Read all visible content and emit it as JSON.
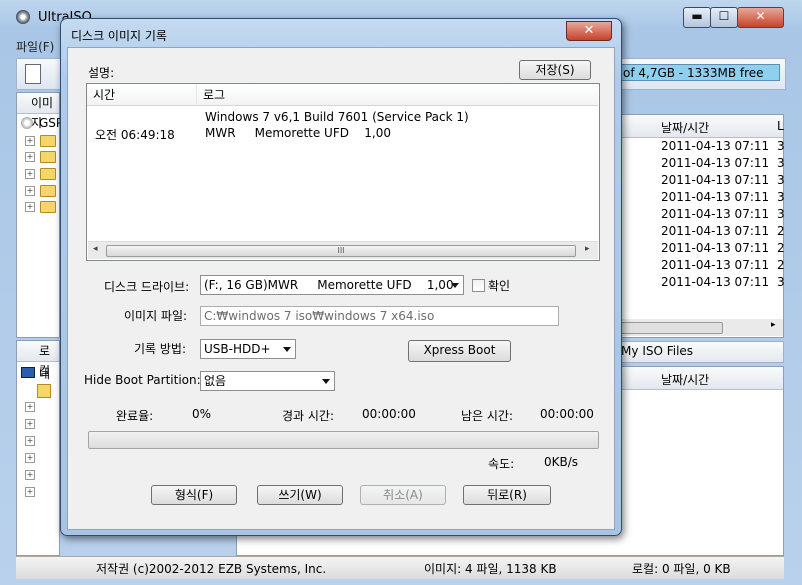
{
  "bg": {
    "title": "UltraISO",
    "menu_file": "파일(F)",
    "capacity_text": "of 4,7GB - 1333MB free",
    "left_tab_top": "이미지",
    "tree_root": "GSP",
    "left_tab_bottom": "로컬",
    "tree_root_local": "내",
    "col_datetime_top": "날짜/시간",
    "col_last_top": "L",
    "dates": [
      "2011-04-13 07:11",
      "2011-04-13 07:11",
      "2011-04-13 07:11",
      "2011-04-13 07:11",
      "2011-04-13 07:11",
      "2011-04-13 07:11",
      "2011-04-13 07:11",
      "2011-04-13 07:11",
      "2011-04-13 07:11"
    ],
    "lastcol": [
      "3",
      "3",
      "3",
      "3",
      "3",
      "2",
      "2",
      "2",
      "3"
    ],
    "path_bottom": "\\My ISO Files",
    "col_datetime_bottom": "날짜/시간",
    "status_copyright": "저작권 (c)2002-2012 EZB Systems, Inc.",
    "status_image": "이미지: 4 파일, 1138 KB",
    "status_local": "로컬: 0 파일, 0 KB"
  },
  "dialog": {
    "title": "디스크 이미지 기록",
    "close_glyph": "✕",
    "desc_label": "설명:",
    "save_button": "저장(S)",
    "log": {
      "col_time": "시간",
      "col_log": "로그",
      "rows": [
        {
          "time": "",
          "text": "Windows 7 v6,1 Build 7601 (Service Pack 1)"
        },
        {
          "time": "오전 06:49:18",
          "text": "MWR     Memorette UFD    1,00"
        }
      ],
      "thumb_grip": "III"
    },
    "drive_label": "디스크 드라이브:",
    "drive_value": "(F:, 16 GB)MWR     Memorette UFD    1,00",
    "verify_label": "확인",
    "image_label": "이미지 파일:",
    "image_value": "C:₩windwos 7 iso₩windows 7 x64.iso",
    "method_label": "기록 방법:",
    "method_value": "USB-HDD+",
    "xpress_button": "Xpress Boot",
    "hide_label": "Hide Boot Partition:",
    "hide_value": "없음",
    "done_label": "완료율:",
    "done_value": "0%",
    "elapsed_label": "경과 시간:",
    "elapsed_value": "00:00:00",
    "remain_label": "남은 시간:",
    "remain_value": "00:00:00",
    "progress": 0,
    "speed_label": "속도:",
    "speed_value": "0KB/s",
    "buttons": {
      "format": "형식(F)",
      "write": "쓰기(W)",
      "cancel": "취소(A)",
      "back": "뒤로(R)"
    }
  }
}
